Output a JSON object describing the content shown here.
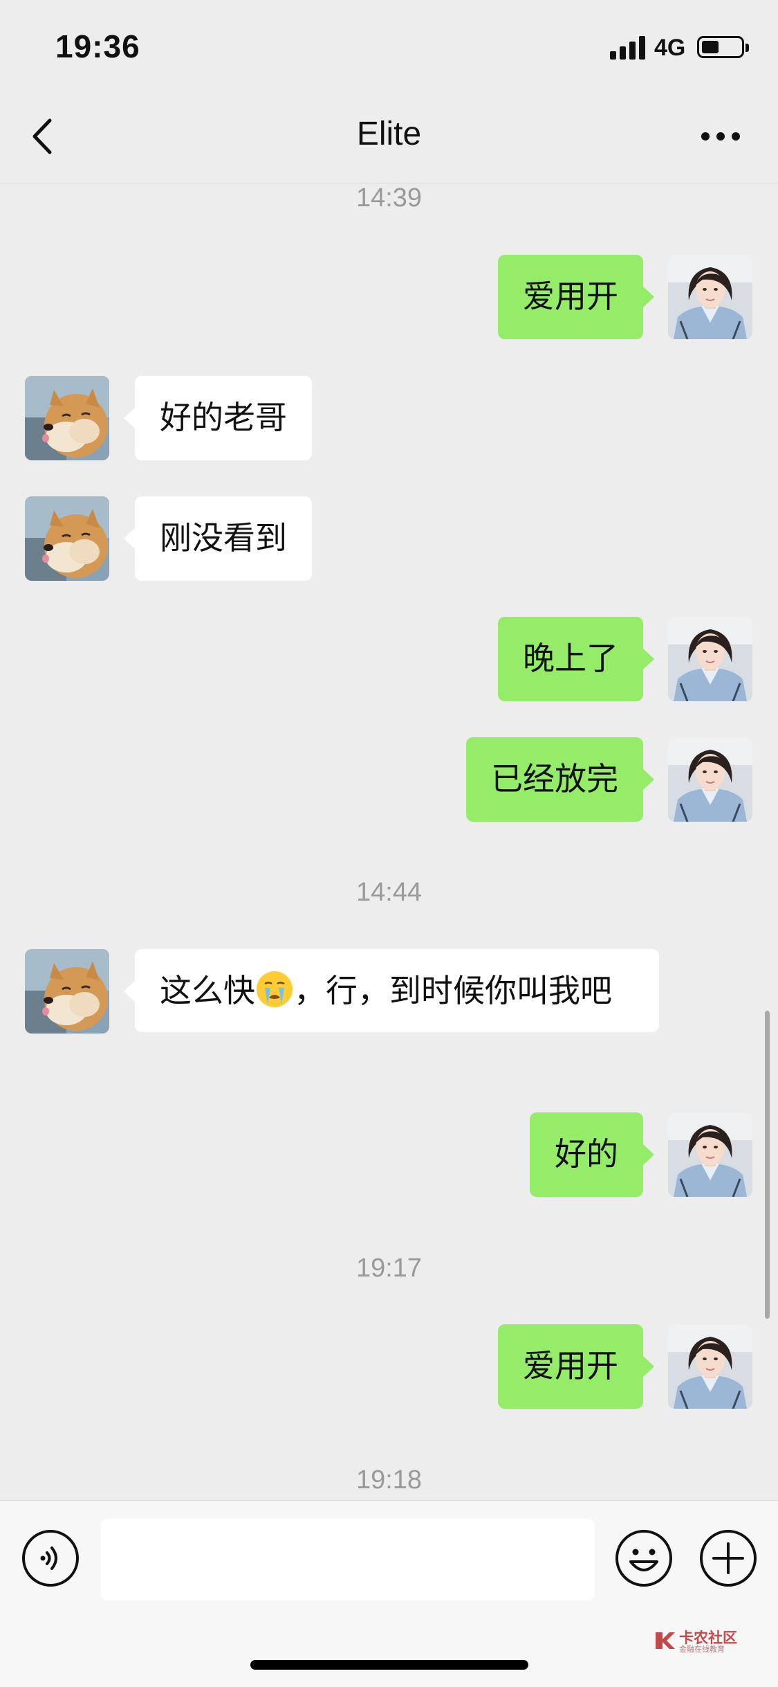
{
  "status_bar": {
    "time": "19:36",
    "network": "4G",
    "icons": [
      "signal-icon",
      "battery-icon"
    ]
  },
  "header": {
    "title": "Elite",
    "back_icon": "chevron-left-icon",
    "more_icon": "ellipsis-icon"
  },
  "chat": {
    "timestamps": [
      "14:39",
      "14:44",
      "19:17",
      "19:18"
    ],
    "messages": [
      {
        "sender": "me",
        "text": "爱用开"
      },
      {
        "sender": "other",
        "text": "好的老哥"
      },
      {
        "sender": "other",
        "text": "刚没看到"
      },
      {
        "sender": "me",
        "text": "晚上了"
      },
      {
        "sender": "me",
        "text": "已经放完"
      },
      {
        "sender": "other",
        "text_before_emoji": "这么快",
        "emoji": "crying-face",
        "text_after_emoji": "，行，到时候你叫我吧"
      },
      {
        "sender": "me",
        "text": "好的"
      },
      {
        "sender": "me",
        "text": "爱用开"
      }
    ]
  },
  "input_bar": {
    "text_value": "",
    "icons": [
      "voice-icon",
      "emoji-icon",
      "plus-icon"
    ]
  },
  "watermark": {
    "main": "卡农社区",
    "sub": "金融在线教育"
  },
  "colors": {
    "background": "#ededed",
    "bubble_me": "#95ec69",
    "bubble_other": "#ffffff",
    "timestamp": "#9a9a9a"
  }
}
